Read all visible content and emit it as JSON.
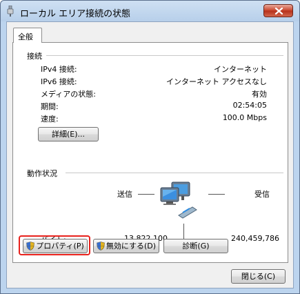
{
  "window": {
    "title": "ローカル エリア接続の状態",
    "close_label": "×"
  },
  "tabs": [
    {
      "label": "全般",
      "active": true
    }
  ],
  "connection": {
    "heading": "接続",
    "rows": [
      {
        "label": "IPv4 接続:",
        "value": "インターネット"
      },
      {
        "label": "IPv6 接続:",
        "value": "インターネット アクセスなし"
      },
      {
        "label": "メディアの状態:",
        "value": "有効"
      },
      {
        "label": "期間:",
        "value": "02:54:05"
      },
      {
        "label": "速度:",
        "value": "100.0 Mbps"
      }
    ],
    "details_button": "詳細(E)..."
  },
  "activity": {
    "heading": "動作状況",
    "sent_label": "送信",
    "received_label": "受信",
    "bytes_label": "バイト:",
    "bytes_sent": "13,822,100",
    "bytes_received": "240,459,786"
  },
  "actions": {
    "properties_button": "プロパティ(P)",
    "disable_button": "無効にする(D)",
    "diagnose_button": "診断(G)"
  },
  "footer": {
    "close_button": "閉じる(C)"
  },
  "colors": {
    "highlight": "#e8211c",
    "close_button": "#c8432a"
  },
  "icons": {
    "title": "network-adapter-icon",
    "shield": "uac-shield-icon",
    "network": "network-computers-icon"
  }
}
